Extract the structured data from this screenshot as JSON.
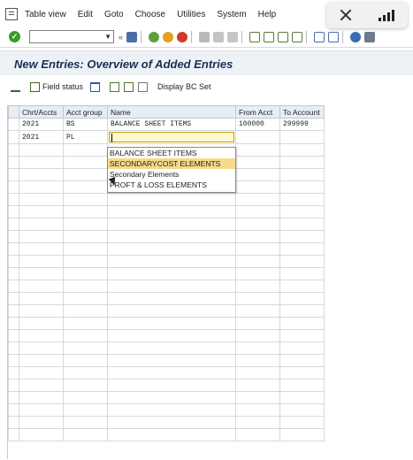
{
  "menu": {
    "items": [
      {
        "label": "Table view",
        "key": "T"
      },
      {
        "label": "Edit",
        "key": "E"
      },
      {
        "label": "Goto",
        "key": "G"
      },
      {
        "label": "Choose",
        "key": "C"
      },
      {
        "label": "Utilities",
        "key": "U"
      },
      {
        "label": "System",
        "key": "S"
      },
      {
        "label": "Help",
        "key": "H"
      }
    ]
  },
  "toolbar": {
    "command_value": "",
    "icons": [
      "ok-icon",
      "save-icon",
      "back-icon",
      "exit-icon",
      "cancel-icon",
      "print-icon",
      "find-icon",
      "find-next-icon",
      "first-page-icon",
      "prev-page-icon",
      "next-page-icon",
      "last-page-icon",
      "new-session-icon",
      "shortcut-icon",
      "help-icon",
      "customize-icon"
    ]
  },
  "title": "New Entries: Overview of Added Entries",
  "app_toolbar": {
    "field_status": "Field status",
    "display_bc_set": "Display BC Set"
  },
  "grid": {
    "columns": [
      "Chrt/Accts",
      "Acct group",
      "Name",
      "From Acct",
      "To Account"
    ],
    "rows": [
      {
        "chart": "2021",
        "group": "BS",
        "name": "BALANCE SHEET ITEMS",
        "from": "100000",
        "to": "299999"
      },
      {
        "chart": "2021",
        "group": "PL",
        "name": "",
        "from": "",
        "to": ""
      }
    ]
  },
  "dropdown": {
    "options": [
      "BALANCE SHEET ITEMS",
      "SECONDARYCOST ELEMENTS",
      "Secondary Elements",
      "PROFT & LOSS ELEMENTS"
    ],
    "highlighted_index": 1
  },
  "colors": {
    "title": "#142f56",
    "highlight": "#f6d98a",
    "ok_green": "#3c9a2f"
  }
}
